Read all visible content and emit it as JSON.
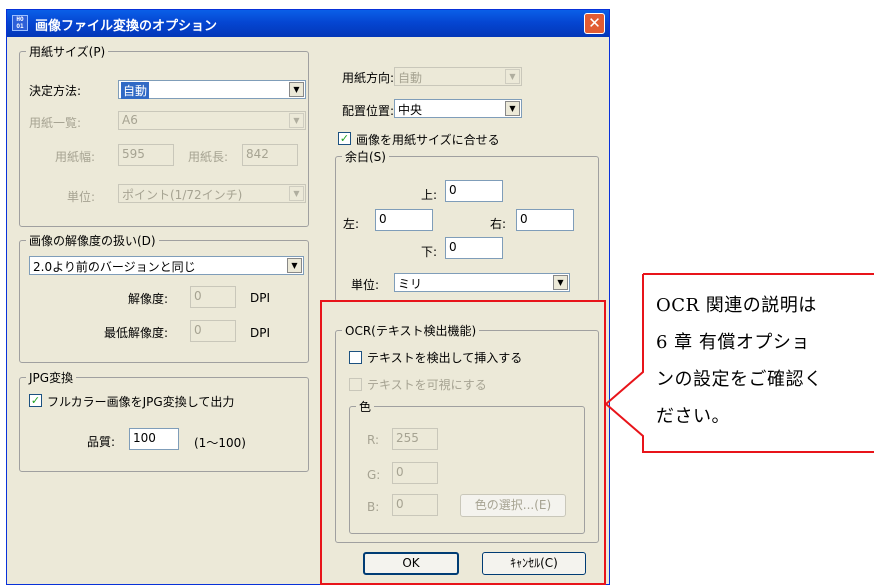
{
  "window": {
    "icon_text": "HO\nO1",
    "title": "画像ファイル変換のオプション",
    "close_glyph": "✕"
  },
  "paper_size": {
    "legend": "用紙サイズ(P)",
    "method_label": "決定方法:",
    "method_value": "自動",
    "list_label": "用紙一覧:",
    "list_value": "A6",
    "width_label": "用紙幅:",
    "width_value": "595",
    "length_label": "用紙長:",
    "length_value": "842",
    "unit_label": "単位:",
    "unit_value": "ポイント(1/72インチ)"
  },
  "resolution": {
    "legend": "画像の解像度の扱い(D)",
    "mode_value": "2.0より前のバージョンと同じ",
    "res_label": "解像度:",
    "res_value": "0",
    "res_unit": "DPI",
    "min_label": "最低解像度:",
    "min_value": "0",
    "min_unit": "DPI"
  },
  "jpg": {
    "legend": "JPG変換",
    "convert_label": "フルカラー画像をJPG変換して出力",
    "convert_checked": true,
    "quality_label": "品質:",
    "quality_value": "100",
    "quality_range": "(1〜100)"
  },
  "orientation": {
    "label": "用紙方向:",
    "value": "自動"
  },
  "placement": {
    "label": "配置位置:",
    "value": "中央"
  },
  "fit": {
    "label": "画像を用紙サイズに合せる",
    "checked": true
  },
  "margin": {
    "legend": "余白(S)",
    "top_label": "上:",
    "top_value": "0",
    "left_label": "左:",
    "left_value": "0",
    "right_label": "右:",
    "right_value": "0",
    "bottom_label": "下:",
    "bottom_value": "0",
    "unit_label": "単位:",
    "unit_value": "ミリ"
  },
  "ocr": {
    "legend": "OCR(テキスト検出機能)",
    "insert_label": "テキストを検出して挿入する",
    "insert_checked": false,
    "visible_label": "テキストを可視にする",
    "visible_checked": false,
    "color_legend": "色",
    "r_label": "R:",
    "r_value": "255",
    "g_label": "G:",
    "g_value": "0",
    "b_label": "B:",
    "b_value": "0",
    "color_button": "色の選択...(E)"
  },
  "buttons": {
    "ok": "OK",
    "cancel": "ｷｬﾝｾﾙ(C)"
  },
  "callout": {
    "line1": "OCR 関連の説明は",
    "line2": "6 章 有償オプショ",
    "line3": "ンの設定をご確認く",
    "line4": "ださい。"
  },
  "colors": {
    "highlight": "#e8141a",
    "titlebar": "#0546d2",
    "dialog_bg": "#ece9d8"
  }
}
